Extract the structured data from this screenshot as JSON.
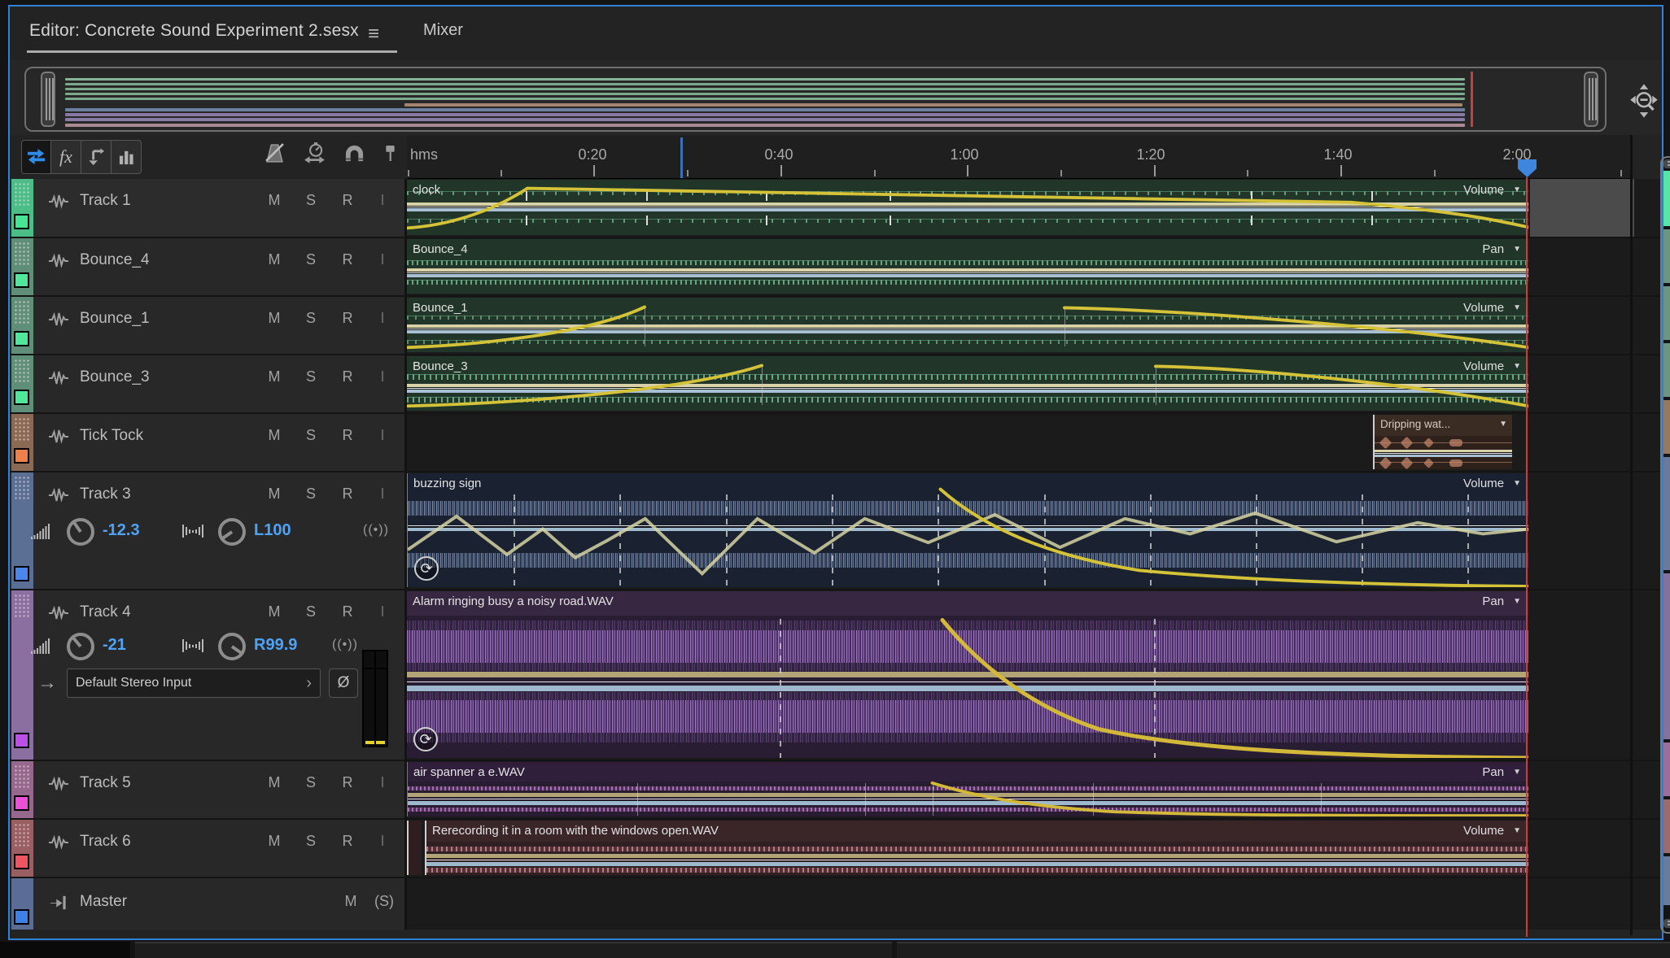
{
  "tabs": {
    "editor": "Editor: Concrete Sound Experiment 2.sesx",
    "mixer": "Mixer"
  },
  "icons": {
    "menu": "≡",
    "caret": "▼",
    "chevron": "›",
    "phase": "Ø",
    "fx": "fx",
    "monitor": "((•))",
    "loop": "⟳"
  },
  "labels": {
    "mute": "M",
    "solo": "S",
    "record": "R",
    "input_monitor": "I",
    "master_solo": "(S)"
  },
  "ruler": {
    "unit": "hms",
    "labels": [
      "0:20",
      "0:40",
      "1:00",
      "1:20",
      "1:40",
      "2:00"
    ]
  },
  "transport": {
    "playhead_position": "2:00"
  },
  "tracks": [
    {
      "name": "Track 1",
      "clip": {
        "label": "clock",
        "automation": "Volume"
      }
    },
    {
      "name": "Bounce_4",
      "clip": {
        "label": "Bounce_4",
        "automation": "Pan"
      }
    },
    {
      "name": "Bounce_1",
      "clip": {
        "label": "Bounce_1",
        "automation": "Volume"
      }
    },
    {
      "name": "Bounce_3",
      "clip": {
        "label": "Bounce_3",
        "automation": "Volume"
      }
    },
    {
      "name": "Tick Tock",
      "clip": {
        "label": "Dripping wat..."
      }
    },
    {
      "name": "Track 3",
      "volume_db": "-12.3",
      "pan": "L100",
      "clip": {
        "label": "buzzing sign",
        "automation": "Volume"
      }
    },
    {
      "name": "Track 4",
      "volume_db": "-21",
      "pan": "R99.9",
      "input": "Default Stereo Input",
      "clip": {
        "label": "Alarm ringing busy a noisy road.WAV",
        "automation": "Pan"
      }
    },
    {
      "name": "Track 5",
      "clip": {
        "label": "air spanner a e.WAV",
        "automation": "Pan"
      }
    },
    {
      "name": "Track 6",
      "clip": {
        "label": "Rerecording it in a room with the windows open.WAV",
        "automation": "Volume"
      }
    },
    {
      "name": "Master"
    }
  ],
  "colors": {
    "accent_blue": "#2f80d8",
    "playhead_red": "#cf3a3a",
    "envelope_yellow": "#d4c238",
    "value_blue": "#4fa3f6",
    "track_swatches": {
      "track1": "#45e595",
      "bounce": "#4fe89a",
      "tick_tock": "#ef7f4b",
      "track3": "#4b86ec",
      "track4": "#bb4fe8",
      "track5": "#ee4fd7",
      "track6": "#ef5560",
      "master": "#3f7fe8"
    }
  }
}
